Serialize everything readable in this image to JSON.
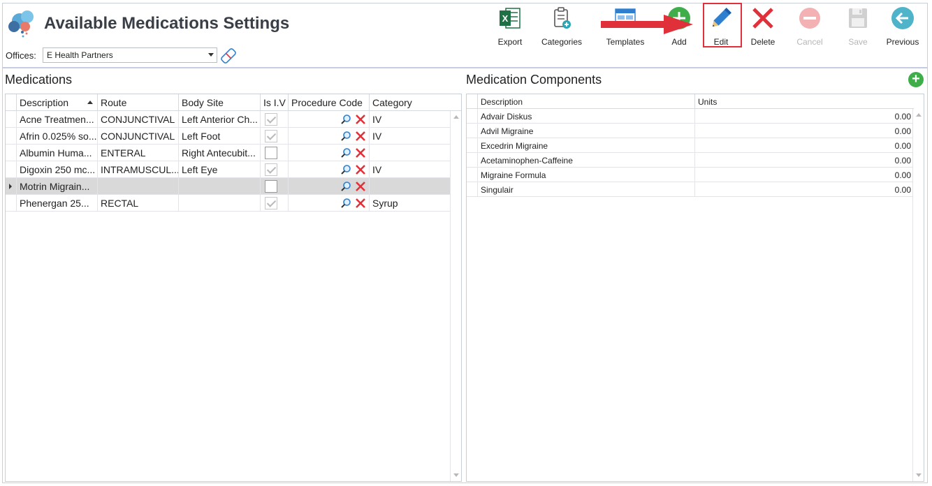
{
  "header": {
    "title": "Available Medications Settings",
    "offices_label": "Offices:",
    "offices_value": "E Health Partners"
  },
  "toolbar": {
    "export": "Export",
    "categories": "Categories",
    "templates": "Templates",
    "add": "Add",
    "edit": "Edit",
    "delete": "Delete",
    "cancel": "Cancel",
    "save": "Save",
    "previous": "Previous"
  },
  "medications": {
    "title": "Medications",
    "columns": [
      "Description",
      "Route",
      "Body Site",
      "Is I.V",
      "Procedure Code",
      "Category"
    ],
    "rows": [
      {
        "description": "Acne Treatmen...",
        "route": "CONJUNCTIVAL",
        "body_site": "Left Anterior Ch...",
        "is_iv": true,
        "category": "IV",
        "selected": false
      },
      {
        "description": "Afrin 0.025% so...",
        "route": "CONJUNCTIVAL",
        "body_site": "Left Foot",
        "is_iv": true,
        "category": "IV",
        "selected": false
      },
      {
        "description": "Albumin Huma...",
        "route": "ENTERAL",
        "body_site": "Right Antecubit...",
        "is_iv": false,
        "category": "",
        "selected": false
      },
      {
        "description": "Digoxin 250 mc...",
        "route": "INTRAMUSCUL...",
        "body_site": "Left Eye",
        "is_iv": true,
        "category": "IV",
        "selected": false
      },
      {
        "description": "Motrin Migrain...",
        "route": "",
        "body_site": "",
        "is_iv": false,
        "category": "",
        "selected": true
      },
      {
        "description": "Phenergan 25...",
        "route": "RECTAL",
        "body_site": "",
        "is_iv": true,
        "category": "Syrup",
        "selected": false
      }
    ]
  },
  "components": {
    "title": "Medication Components",
    "columns": [
      "Description",
      "Units"
    ],
    "rows": [
      {
        "description": "Advair Diskus",
        "units": "0.00"
      },
      {
        "description": "Advil Migraine",
        "units": "0.00"
      },
      {
        "description": "Excedrin Migraine",
        "units": "0.00"
      },
      {
        "description": "Acetaminophen-Caffeine",
        "units": "0.00"
      },
      {
        "description": "Migraine Formula",
        "units": "0.00"
      },
      {
        "description": "Singulair",
        "units": "0.00"
      }
    ]
  },
  "colors": {
    "highlight_red": "#e0303a",
    "add_green": "#3fae4a",
    "edit_blue": "#2f7fd1",
    "selected_row": "#d9d9d9"
  }
}
